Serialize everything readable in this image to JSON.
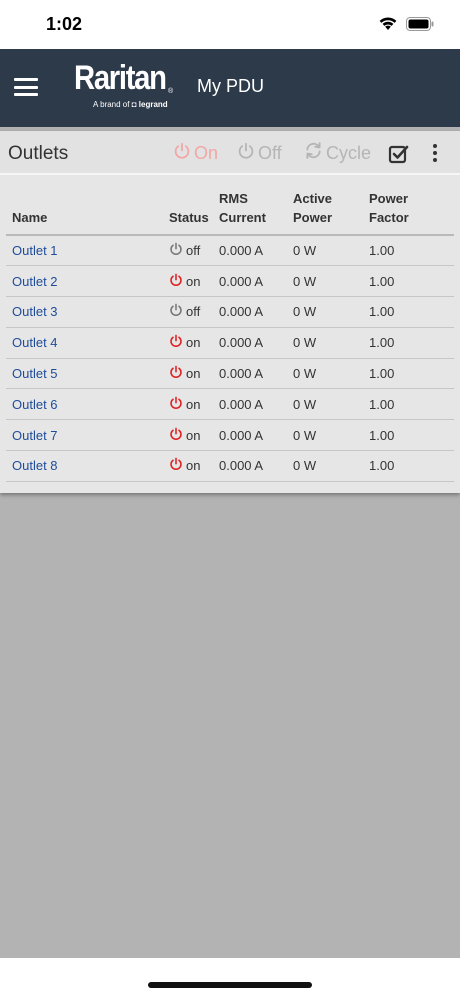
{
  "status_bar": {
    "time": "1:02"
  },
  "header": {
    "brand": "Raritan",
    "brand_tagline_prefix": "A brand of",
    "brand_tagline_company": "legrand",
    "title": "My PDU"
  },
  "toolbar": {
    "title": "Outlets",
    "on_label": "On",
    "off_label": "Off",
    "cycle_label": "Cycle"
  },
  "table": {
    "headers": {
      "name": "Name",
      "status": "Status",
      "current_line1": "RMS",
      "current_line2": "Current",
      "power_line1": "Active",
      "power_line2": "Power",
      "factor_line1": "Power",
      "factor_line2": "Factor"
    },
    "rows": [
      {
        "name": "Outlet 1",
        "status": "off",
        "current": "0.000 A",
        "power": "0 W",
        "factor": "1.00"
      },
      {
        "name": "Outlet 2",
        "status": "on",
        "current": "0.000 A",
        "power": "0 W",
        "factor": "1.00"
      },
      {
        "name": "Outlet 3",
        "status": "off",
        "current": "0.000 A",
        "power": "0 W",
        "factor": "1.00"
      },
      {
        "name": "Outlet 4",
        "status": "on",
        "current": "0.000 A",
        "power": "0 W",
        "factor": "1.00"
      },
      {
        "name": "Outlet 5",
        "status": "on",
        "current": "0.000 A",
        "power": "0 W",
        "factor": "1.00"
      },
      {
        "name": "Outlet 6",
        "status": "on",
        "current": "0.000 A",
        "power": "0 W",
        "factor": "1.00"
      },
      {
        "name": "Outlet 7",
        "status": "on",
        "current": "0.000 A",
        "power": "0 W",
        "factor": "1.00"
      },
      {
        "name": "Outlet 8",
        "status": "on",
        "current": "0.000 A",
        "power": "0 W",
        "factor": "1.00"
      }
    ]
  },
  "colors": {
    "header_bg": "#2d3a4a",
    "link": "#1f4c99",
    "power_on": "#e02020",
    "power_off": "#777777"
  }
}
